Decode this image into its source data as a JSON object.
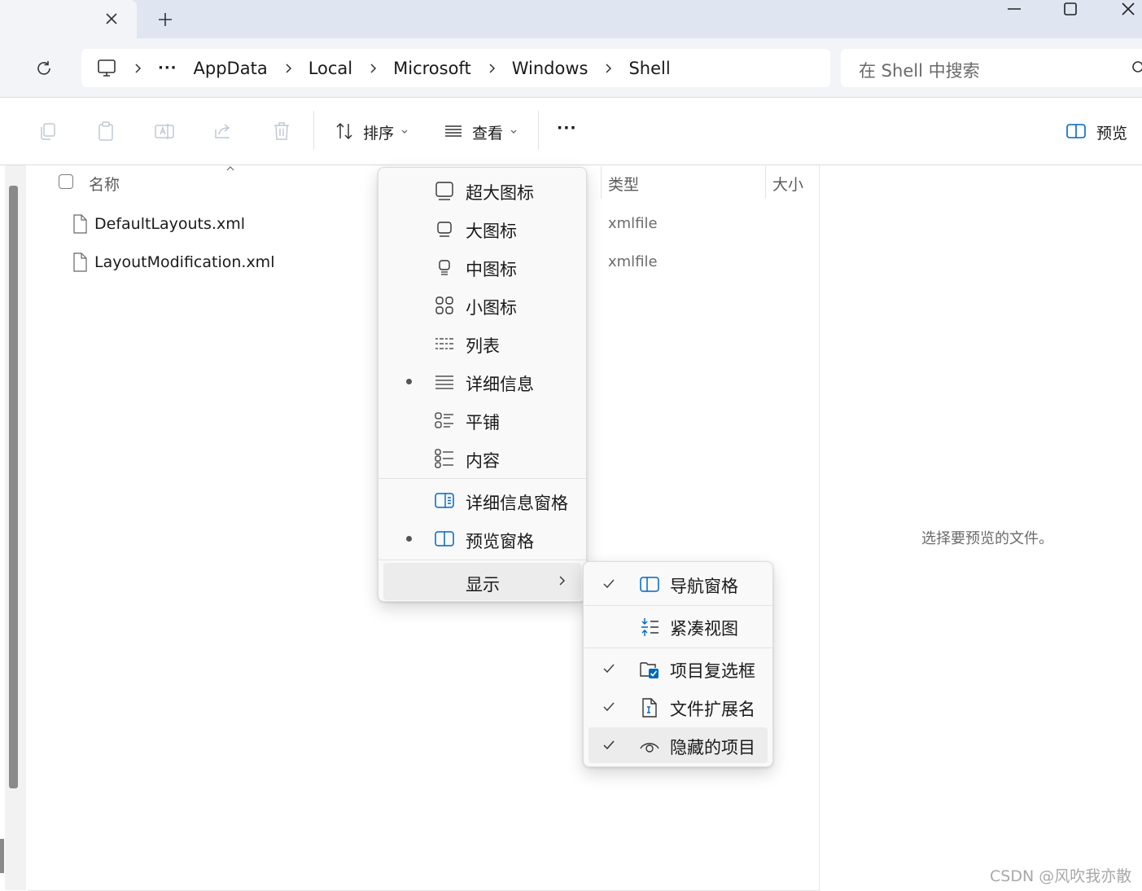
{
  "window": {
    "tab_close_icon": "close-icon",
    "new_tab_icon": "plus-icon",
    "controls": [
      "minimize-icon",
      "maximize-icon",
      "close-icon"
    ]
  },
  "address_bar": {
    "refresh_icon": "refresh-icon",
    "root_icon": "this-pc-icon",
    "overflow": "···",
    "breadcrumbs": [
      "AppData",
      "Local",
      "Microsoft",
      "Windows",
      "Shell"
    ],
    "search_placeholder": "在 Shell 中搜索"
  },
  "command_bar": {
    "disabled_icons": [
      "copy-icon",
      "paste-icon",
      "rename-icon",
      "share-icon",
      "delete-icon"
    ],
    "sort_label": "排序",
    "view_label": "查看",
    "more_label": "···",
    "preview_label": "预览"
  },
  "file_list": {
    "columns": {
      "name": "名称",
      "type": "类型",
      "size": "大小"
    },
    "files": [
      {
        "name": "DefaultLayouts.xml",
        "type": "xmlfile"
      },
      {
        "name": "LayoutModification.xml",
        "type": "xmlfile"
      }
    ]
  },
  "preview_pane": {
    "message": "选择要预览的文件。"
  },
  "view_menu": {
    "items": [
      {
        "label": "超大图标",
        "icon": "extra-large-icons-icon",
        "selected": false
      },
      {
        "label": "大图标",
        "icon": "large-icons-icon",
        "selected": false
      },
      {
        "label": "中图标",
        "icon": "medium-icons-icon",
        "selected": false
      },
      {
        "label": "小图标",
        "icon": "small-icons-icon",
        "selected": false
      },
      {
        "label": "列表",
        "icon": "list-icon",
        "selected": false
      },
      {
        "label": "详细信息",
        "icon": "details-icon",
        "selected": true
      },
      {
        "label": "平铺",
        "icon": "tiles-icon",
        "selected": false
      },
      {
        "label": "内容",
        "icon": "content-icon",
        "selected": false
      }
    ],
    "panes": [
      {
        "label": "详细信息窗格",
        "icon": "details-pane-icon",
        "selected": false
      },
      {
        "label": "预览窗格",
        "icon": "preview-pane-icon",
        "selected": true
      }
    ],
    "show_label": "显示"
  },
  "show_menu": {
    "items": [
      {
        "label": "导航窗格",
        "icon": "navigation-pane-icon",
        "checked": true
      },
      {
        "label": "紧凑视图",
        "icon": "compact-view-icon",
        "checked": false
      },
      {
        "label": "项目复选框",
        "icon": "item-checkboxes-icon",
        "checked": true
      },
      {
        "label": "文件扩展名",
        "icon": "file-extensions-icon",
        "checked": true
      },
      {
        "label": "隐藏的项目",
        "icon": "hidden-items-icon",
        "checked": true
      }
    ]
  },
  "watermark": "CSDN @风吹我亦散",
  "colors": {
    "accent": "#0067c0",
    "tabstrip": "#dfe5f1",
    "toolbar": "#f2f4f8"
  }
}
